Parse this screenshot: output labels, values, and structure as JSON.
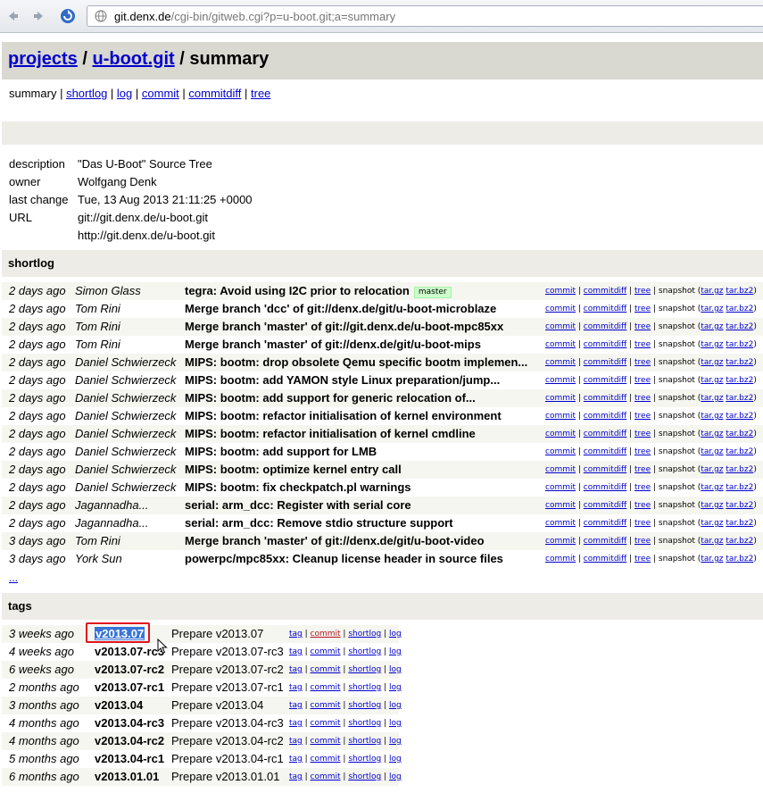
{
  "browser": {
    "url_host": "git.denx.de",
    "url_path": "/cgi-bin/gitweb.cgi?p=u-boot.git;a=summary"
  },
  "header": {
    "projects": "projects",
    "sep": " / ",
    "repo": "u-boot.git",
    "page": "summary"
  },
  "nav": [
    "summary",
    "shortlog",
    "log",
    "commit",
    "commitdiff",
    "tree"
  ],
  "project_info": [
    {
      "key": "description",
      "value": "\"Das U-Boot\" Source Tree"
    },
    {
      "key": "owner",
      "value": "Wolfgang Denk"
    },
    {
      "key": "last change",
      "value": "Tue, 13 Aug 2013 21:11:25 +0000"
    },
    {
      "key": "URL",
      "value": "git://git.denx.de/u-boot.git"
    },
    {
      "key": "",
      "value": "http://git.denx.de/u-boot.git"
    }
  ],
  "shortlog": {
    "title": "shortlog",
    "link_labels": {
      "commit": "commit",
      "commitdiff": "commitdiff",
      "tree": "tree",
      "snapshot": "snapshot",
      "targz": "tar.gz",
      "tarbz2": "tar.bz2"
    },
    "rows": [
      {
        "age": "2 days ago",
        "author": "Simon Glass",
        "subject": "tegra: Avoid using I2C prior to relocation",
        "ref": "master"
      },
      {
        "age": "2 days ago",
        "author": "Tom Rini",
        "subject": "Merge branch 'dcc' of git://denx.de/git/u-boot-microblaze"
      },
      {
        "age": "2 days ago",
        "author": "Tom Rini",
        "subject": "Merge branch 'master' of git://git.denx.de/u-boot-mpc85xx"
      },
      {
        "age": "2 days ago",
        "author": "Tom Rini",
        "subject": "Merge branch 'master' of git://denx.de/git/u-boot-mips"
      },
      {
        "age": "2 days ago",
        "author": "Daniel Schwierzeck",
        "subject": "MIPS: bootm: drop obsolete Qemu specific bootm implemen..."
      },
      {
        "age": "2 days ago",
        "author": "Daniel Schwierzeck",
        "subject": "MIPS: bootm: add YAMON style Linux preparation/jump..."
      },
      {
        "age": "2 days ago",
        "author": "Daniel Schwierzeck",
        "subject": "MIPS: bootm: add support for generic relocation of..."
      },
      {
        "age": "2 days ago",
        "author": "Daniel Schwierzeck",
        "subject": "MIPS: bootm: refactor initialisation of kernel environment"
      },
      {
        "age": "2 days ago",
        "author": "Daniel Schwierzeck",
        "subject": "MIPS: bootm: refactor initialisation of kernel cmdline"
      },
      {
        "age": "2 days ago",
        "author": "Daniel Schwierzeck",
        "subject": "MIPS: bootm: add support for LMB"
      },
      {
        "age": "2 days ago",
        "author": "Daniel Schwierzeck",
        "subject": "MIPS: bootm: optimize kernel entry call"
      },
      {
        "age": "2 days ago",
        "author": "Daniel Schwierzeck",
        "subject": "MIPS: bootm: fix checkpatch.pl warnings"
      },
      {
        "age": "2 days ago",
        "author": "Jagannadha...",
        "subject": "serial: arm_dcc: Register with serial core"
      },
      {
        "age": "2 days ago",
        "author": "Jagannadha...",
        "subject": "serial: arm_dcc: Remove stdio structure support"
      },
      {
        "age": "3 days ago",
        "author": "Tom Rini",
        "subject": "Merge branch 'master' of git://denx.de/git/u-boot-video"
      },
      {
        "age": "3 days ago",
        "author": "York Sun",
        "subject": "powerpc/mpc85xx: Cleanup license header in source files"
      }
    ],
    "more": "..."
  },
  "tags": {
    "title": "tags",
    "link_labels": {
      "tag": "tag",
      "commit": "commit",
      "shortlog": "shortlog",
      "log": "log"
    },
    "rows": [
      {
        "age": "3 weeks ago",
        "name": "v2013.07",
        "msg": "Prepare v2013.07"
      },
      {
        "age": "4 weeks ago",
        "name": "v2013.07-rc3",
        "msg": "Prepare v2013.07-rc3"
      },
      {
        "age": "6 weeks ago",
        "name": "v2013.07-rc2",
        "msg": "Prepare v2013.07-rc2"
      },
      {
        "age": "2 months ago",
        "name": "v2013.07-rc1",
        "msg": "Prepare v2013.07-rc1"
      },
      {
        "age": "3 months ago",
        "name": "v2013.04",
        "msg": "Prepare v2013.04"
      },
      {
        "age": "4 months ago",
        "name": "v2013.04-rc3",
        "msg": "Prepare v2013.04-rc3"
      },
      {
        "age": "4 months ago",
        "name": "v2013.04-rc2",
        "msg": "Prepare v2013.04-rc2"
      },
      {
        "age": "5 months ago",
        "name": "v2013.04-rc1",
        "msg": "Prepare v2013.04-rc1"
      },
      {
        "age": "6 months ago",
        "name": "v2013.01.01",
        "msg": "Prepare v2013.01.01"
      }
    ]
  }
}
